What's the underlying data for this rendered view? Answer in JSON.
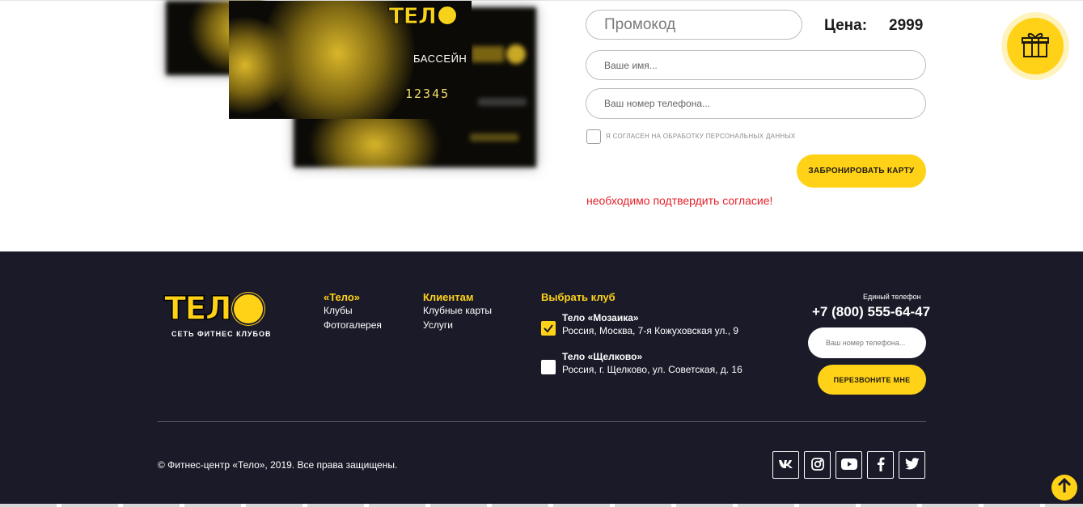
{
  "cards": {
    "type_label": "БАССЕЙН",
    "number": "12345",
    "logo_text": "ТЕЛ"
  },
  "form": {
    "promo_placeholder": "Промокод",
    "price_label": "Цена:",
    "price_value": "2999",
    "name_placeholder": "Ваше имя...",
    "phone_placeholder": "Ваш номер телефона...",
    "consent_text": "Я согласен на обработку персональных данных",
    "reserve_button": "ЗАБРОНИРОВАТЬ КАРТУ",
    "error_text": "необходимо подтвердить согласие!"
  },
  "gift": {
    "icon": "gift-icon"
  },
  "footer": {
    "logo_text": "ТЕЛ",
    "logo_sub": "СЕТЬ ФИТНЕС КЛУБОВ",
    "columns": [
      {
        "title": "«Тело»",
        "links": [
          "Клубы",
          "Фотогалерея"
        ]
      },
      {
        "title": "Клиентам",
        "links": [
          "Клубные карты",
          "Услуги"
        ]
      }
    ],
    "clubs_title": "Выбрать клуб",
    "clubs": [
      {
        "name": "Тело «Мозаика»",
        "address": "Россия, Москва, 7-я Кожуховская ул., 9",
        "checked": true
      },
      {
        "name": "Тело «Щелково»",
        "address": "Россия, г. Щелково, ул. Советская, д. 16",
        "checked": false
      }
    ],
    "phone_label": "Единый телефон",
    "phone_number": "+7 (800) 555-64-47",
    "phone_placeholder": "Ваш номер телефона...",
    "callback_button": "ПЕРЕЗВОНИТЕ МНЕ",
    "copyright": "© Фитнес-центр «Тело», 2019. Все права защищены.",
    "social": [
      "vk-icon",
      "instagram-icon",
      "youtube-icon",
      "facebook-icon",
      "twitter-icon"
    ]
  },
  "colors": {
    "accent": "#ffd217",
    "footer_bg": "#1a1a29",
    "error": "#e3202a"
  }
}
